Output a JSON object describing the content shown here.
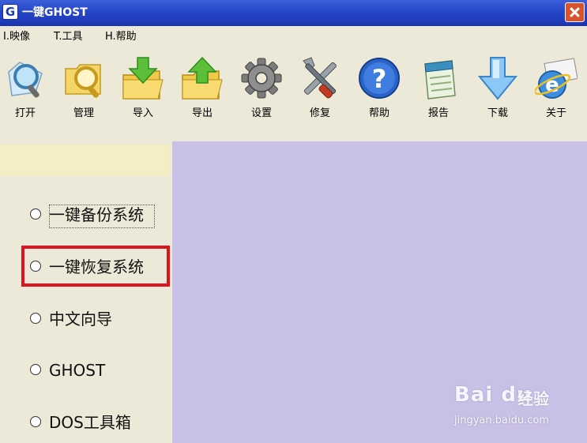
{
  "window": {
    "app_icon_letter": "G",
    "title": "一键GHOST"
  },
  "menu": [
    {
      "label": "I.映像"
    },
    {
      "label": "T.工具"
    },
    {
      "label": "H.帮助"
    }
  ],
  "toolbar": [
    {
      "label": "打开",
      "icon": "open-magnifier-icon"
    },
    {
      "label": "管理",
      "icon": "folder-search-icon"
    },
    {
      "label": "导入",
      "icon": "folder-import-icon"
    },
    {
      "label": "导出",
      "icon": "folder-export-icon"
    },
    {
      "label": "设置",
      "icon": "gear-icon"
    },
    {
      "label": "修复",
      "icon": "tools-icon"
    },
    {
      "label": "帮助",
      "icon": "help-icon"
    },
    {
      "label": "报告",
      "icon": "notepad-icon"
    },
    {
      "label": "下载",
      "icon": "download-arrow-icon"
    },
    {
      "label": "关于",
      "icon": "ie-mail-icon"
    }
  ],
  "options": [
    {
      "label": "一键备份系统"
    },
    {
      "label": "一键恢复系统"
    },
    {
      "label": "中文向导"
    },
    {
      "label": "GHOST"
    },
    {
      "label": "DOS工具箱"
    }
  ],
  "watermark": {
    "logo": "Bai du",
    "text": "经验",
    "url": "jingyan.baidu.com"
  },
  "colors": {
    "titlebar": "#2646c8",
    "right_panel": "#c8c0e6",
    "highlight": "#e0121b",
    "panel_header": "#f5edc4"
  }
}
